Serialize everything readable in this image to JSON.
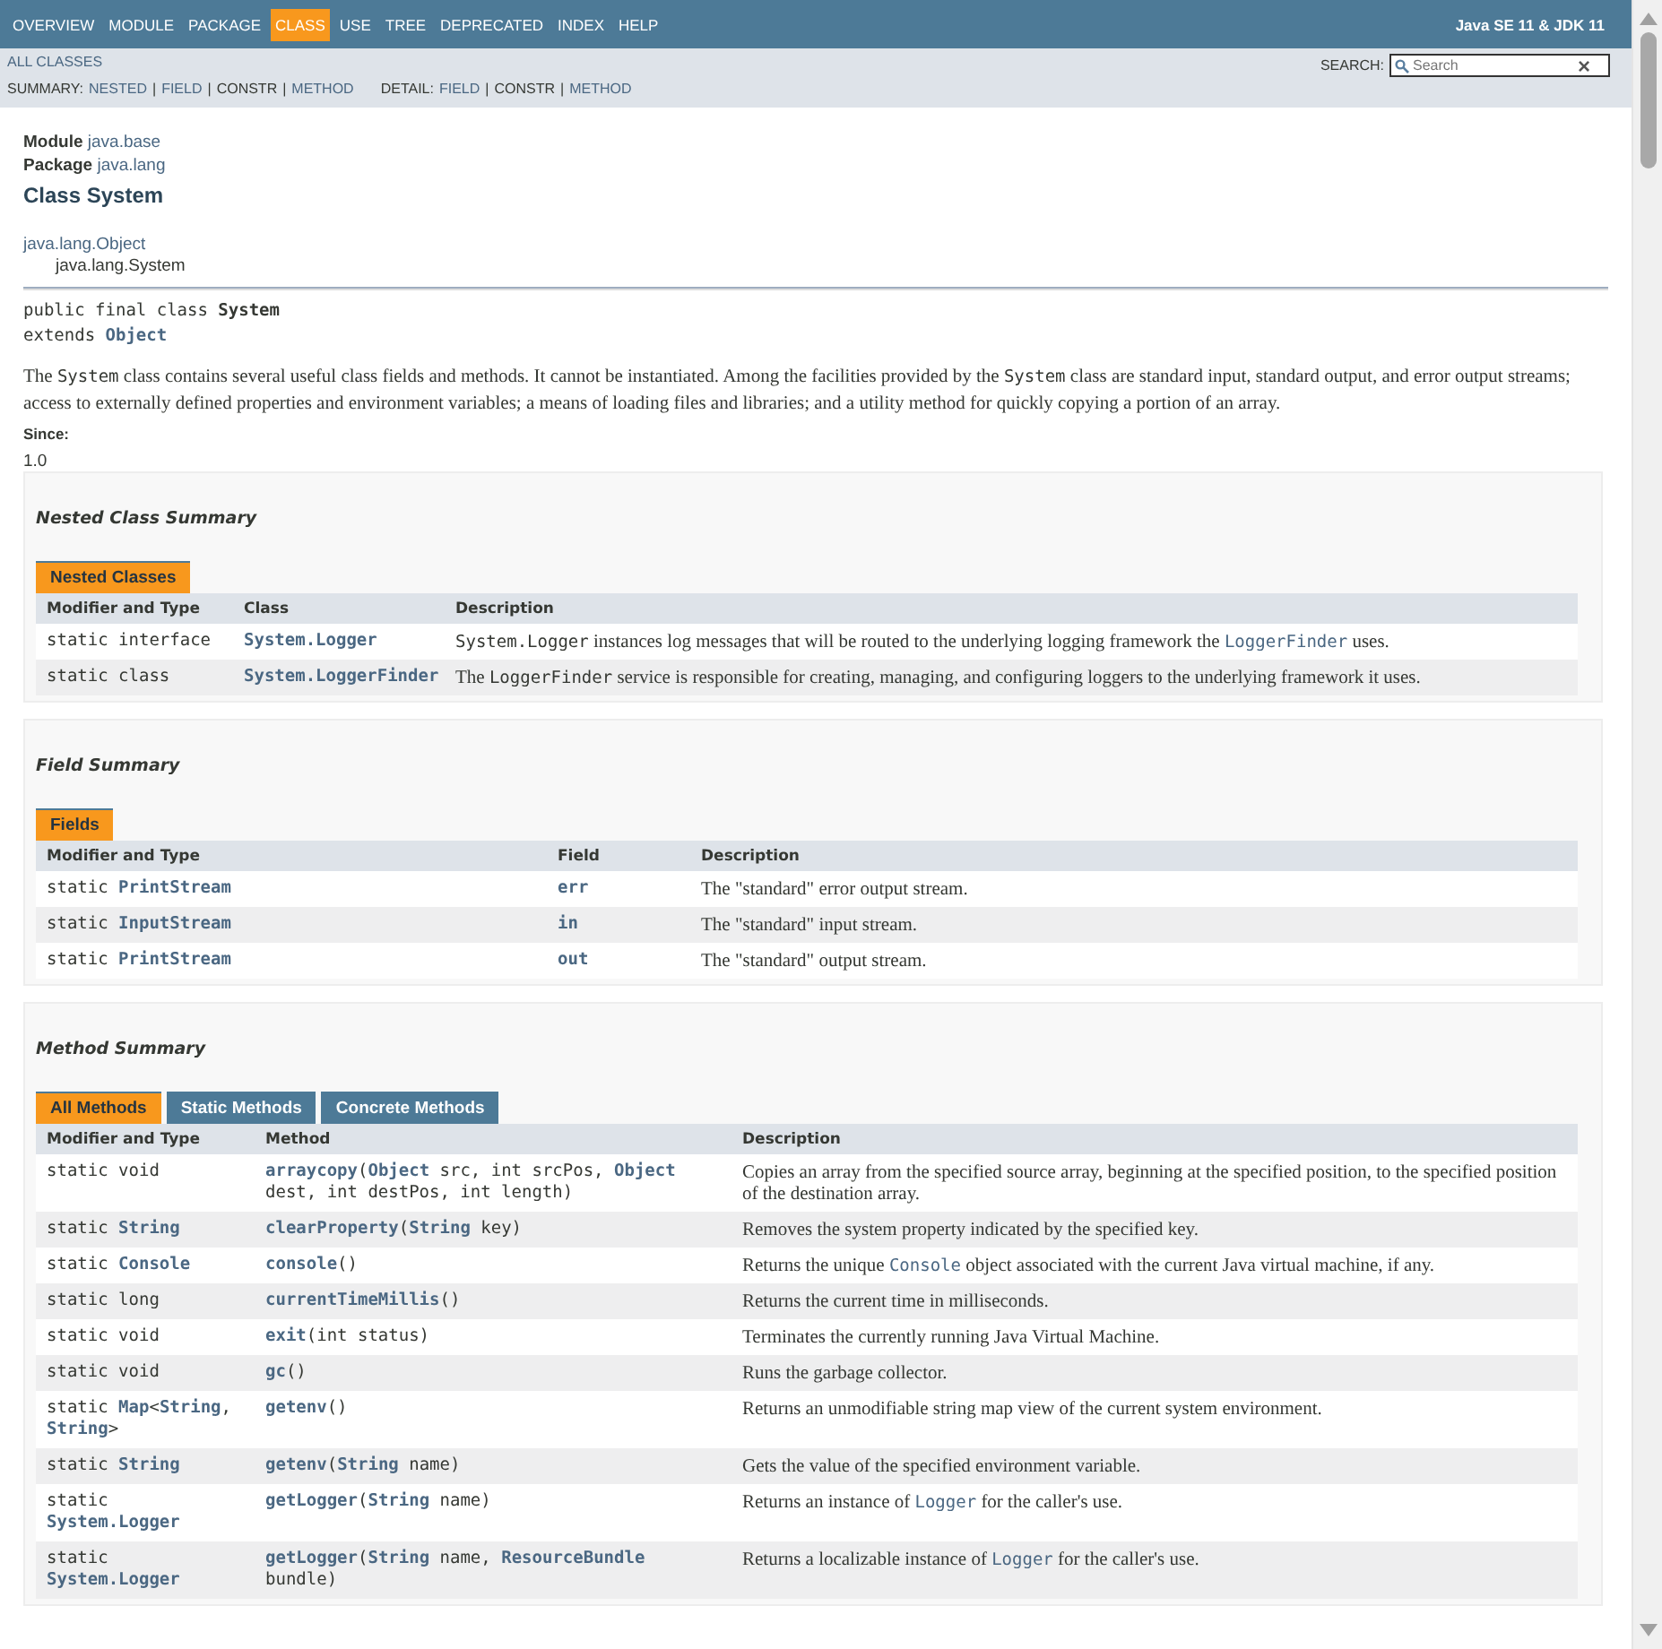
{
  "nav": {
    "items": [
      {
        "label": "OVERVIEW",
        "selected": false
      },
      {
        "label": "MODULE",
        "selected": false
      },
      {
        "label": "PACKAGE",
        "selected": false
      },
      {
        "label": "CLASS",
        "selected": true
      },
      {
        "label": "USE",
        "selected": false
      },
      {
        "label": "TREE",
        "selected": false
      },
      {
        "label": "DEPRECATED",
        "selected": false
      },
      {
        "label": "INDEX",
        "selected": false
      },
      {
        "label": "HELP",
        "selected": false
      }
    ],
    "product": "Java SE 11 & JDK 11"
  },
  "subnav": {
    "all_classes": "ALL CLASSES",
    "separator": "|",
    "summary": {
      "label": "SUMMARY:",
      "items": [
        {
          "label": "NESTED",
          "disabled": false
        },
        {
          "label": "FIELD",
          "disabled": false
        },
        {
          "label": "CONSTR",
          "disabled": true
        },
        {
          "label": "METHOD",
          "disabled": false
        }
      ]
    },
    "detail": {
      "label": "DETAIL:",
      "items": [
        {
          "label": "FIELD",
          "disabled": false
        },
        {
          "label": "CONSTR",
          "disabled": true
        },
        {
          "label": "METHOD",
          "disabled": false
        }
      ]
    },
    "search": {
      "label": "SEARCH:",
      "placeholder": "Search",
      "clear": "×"
    }
  },
  "header": {
    "module_label": "Module",
    "module": "java.base",
    "package_label": "Package",
    "package": "java.lang",
    "title": "Class System",
    "hierarchy": [
      "java.lang.Object",
      "java.lang.System"
    ],
    "declaration": [
      [
        {
          "kind": "code",
          "text": "public final class "
        },
        {
          "kind": "bold",
          "text": "System"
        }
      ],
      [
        {
          "kind": "code",
          "text": "extends "
        },
        {
          "kind": "link",
          "text": "Object"
        }
      ]
    ],
    "description": [
      {
        "kind": "text",
        "text": "The "
      },
      {
        "kind": "code",
        "text": "System"
      },
      {
        "kind": "text",
        "text": " class contains several useful class fields and methods. It cannot be instantiated. Among the facilities provided by the "
      },
      {
        "kind": "code",
        "text": "System"
      },
      {
        "kind": "text",
        "text": " class are standard input, standard output, and error output streams; access to externally defined properties and environment variables; a means of loading files and libraries; and a utility method for quickly copying a portion of an array."
      }
    ],
    "since_label": "Since:",
    "since": "1.0"
  },
  "sections": [
    {
      "kind": "nested",
      "title": "Nested Class Summary",
      "tabs": [
        {
          "label": "Nested Classes",
          "selected": true
        }
      ],
      "columns": [
        "Modifier and Type",
        "Class",
        "Description"
      ],
      "rows": [
        [
          [
            {
              "kind": "code",
              "text": "static interface"
            }
          ],
          [
            {
              "kind": "link",
              "text": "System.Logger"
            }
          ],
          [
            {
              "kind": "code",
              "text": "System.Logger"
            },
            {
              "kind": "text",
              "text": " instances log messages that will be routed to the underlying logging framework the "
            },
            {
              "kind": "ref",
              "text": "LoggerFinder"
            },
            {
              "kind": "text",
              "text": " uses."
            }
          ]
        ],
        [
          [
            {
              "kind": "code",
              "text": "static class"
            }
          ],
          [
            {
              "kind": "link",
              "text": "System.LoggerFinder"
            }
          ],
          [
            {
              "kind": "text",
              "text": "The "
            },
            {
              "kind": "code",
              "text": "LoggerFinder"
            },
            {
              "kind": "text",
              "text": " service is responsible for creating, managing, and configuring loggers to the underlying framework it uses."
            }
          ]
        ]
      ]
    },
    {
      "kind": "field",
      "title": "Field Summary",
      "tabs": [
        {
          "label": "Fields",
          "selected": true
        }
      ],
      "columns": [
        "Modifier and Type",
        "Field",
        "Description"
      ],
      "rows": [
        [
          [
            {
              "kind": "code",
              "text": "static "
            },
            {
              "kind": "link",
              "text": "PrintStream"
            }
          ],
          [
            {
              "kind": "link",
              "text": "err"
            }
          ],
          [
            {
              "kind": "text",
              "text": "The \"standard\" error output stream."
            }
          ]
        ],
        [
          [
            {
              "kind": "code",
              "text": "static "
            },
            {
              "kind": "link",
              "text": "InputStream"
            }
          ],
          [
            {
              "kind": "link",
              "text": "in"
            }
          ],
          [
            {
              "kind": "text",
              "text": "The \"standard\" input stream."
            }
          ]
        ],
        [
          [
            {
              "kind": "code",
              "text": "static "
            },
            {
              "kind": "link",
              "text": "PrintStream"
            }
          ],
          [
            {
              "kind": "link",
              "text": "out"
            }
          ],
          [
            {
              "kind": "text",
              "text": "The \"standard\" output stream."
            }
          ]
        ]
      ]
    },
    {
      "kind": "method",
      "title": "Method Summary",
      "tabs": [
        {
          "label": "All Methods",
          "selected": true
        },
        {
          "label": "Static Methods",
          "selected": false
        },
        {
          "label": "Concrete Methods",
          "selected": false
        }
      ],
      "columns": [
        "Modifier and Type",
        "Method",
        "Description"
      ],
      "rows": [
        [
          [
            {
              "kind": "code",
              "text": "static void"
            }
          ],
          [
            {
              "kind": "link",
              "text": "arraycopy"
            },
            {
              "kind": "code",
              "text": "("
            },
            {
              "kind": "link",
              "text": "Object"
            },
            {
              "kind": "code",
              "text": " src, int srcPos, "
            },
            {
              "kind": "link",
              "text": "Object"
            },
            {
              "kind": "code",
              "text": " dest, int destPos, int length)"
            }
          ],
          [
            {
              "kind": "text",
              "text": "Copies an array from the specified source array, beginning at the specified position, to the specified position of the destination array."
            }
          ]
        ],
        [
          [
            {
              "kind": "code",
              "text": "static "
            },
            {
              "kind": "link",
              "text": "String"
            }
          ],
          [
            {
              "kind": "link",
              "text": "clearProperty"
            },
            {
              "kind": "code",
              "text": "("
            },
            {
              "kind": "link",
              "text": "String"
            },
            {
              "kind": "code",
              "text": " key)"
            }
          ],
          [
            {
              "kind": "text",
              "text": "Removes the system property indicated by the specified key."
            }
          ]
        ],
        [
          [
            {
              "kind": "code",
              "text": "static "
            },
            {
              "kind": "link",
              "text": "Console"
            }
          ],
          [
            {
              "kind": "link",
              "text": "console"
            },
            {
              "kind": "code",
              "text": "()"
            }
          ],
          [
            {
              "kind": "text",
              "text": "Returns the unique "
            },
            {
              "kind": "ref",
              "text": "Console"
            },
            {
              "kind": "text",
              "text": " object associated with the current Java virtual machine, if any."
            }
          ]
        ],
        [
          [
            {
              "kind": "code",
              "text": "static long"
            }
          ],
          [
            {
              "kind": "link",
              "text": "currentTimeMillis"
            },
            {
              "kind": "code",
              "text": "()"
            }
          ],
          [
            {
              "kind": "text",
              "text": "Returns the current time in milliseconds."
            }
          ]
        ],
        [
          [
            {
              "kind": "code",
              "text": "static void"
            }
          ],
          [
            {
              "kind": "link",
              "text": "exit"
            },
            {
              "kind": "code",
              "text": "(int status)"
            }
          ],
          [
            {
              "kind": "text",
              "text": "Terminates the currently running Java Virtual Machine."
            }
          ]
        ],
        [
          [
            {
              "kind": "code",
              "text": "static void"
            }
          ],
          [
            {
              "kind": "link",
              "text": "gc"
            },
            {
              "kind": "code",
              "text": "()"
            }
          ],
          [
            {
              "kind": "text",
              "text": "Runs the garbage collector."
            }
          ]
        ],
        [
          [
            {
              "kind": "code",
              "text": "static "
            },
            {
              "kind": "link",
              "text": "Map"
            },
            {
              "kind": "code",
              "text": "<"
            },
            {
              "kind": "link",
              "text": "String"
            },
            {
              "kind": "code",
              "text": ", "
            },
            {
              "kind": "link",
              "text": "String"
            },
            {
              "kind": "code",
              "text": ">"
            }
          ],
          [
            {
              "kind": "link",
              "text": "getenv"
            },
            {
              "kind": "code",
              "text": "()"
            }
          ],
          [
            {
              "kind": "text",
              "text": "Returns an unmodifiable string map view of the current system environment."
            }
          ]
        ],
        [
          [
            {
              "kind": "code",
              "text": "static "
            },
            {
              "kind": "link",
              "text": "String"
            }
          ],
          [
            {
              "kind": "link",
              "text": "getenv"
            },
            {
              "kind": "code",
              "text": "("
            },
            {
              "kind": "link",
              "text": "String"
            },
            {
              "kind": "code",
              "text": " name)"
            }
          ],
          [
            {
              "kind": "text",
              "text": "Gets the value of the specified environment variable."
            }
          ]
        ],
        [
          [
            {
              "kind": "code",
              "text": "static "
            },
            {
              "kind": "link",
              "text": "System.Logger"
            }
          ],
          [
            {
              "kind": "link",
              "text": "getLogger"
            },
            {
              "kind": "code",
              "text": "("
            },
            {
              "kind": "link",
              "text": "String"
            },
            {
              "kind": "code",
              "text": " name)"
            }
          ],
          [
            {
              "kind": "text",
              "text": "Returns an instance of "
            },
            {
              "kind": "ref",
              "text": "Logger"
            },
            {
              "kind": "text",
              "text": " for the caller's use."
            }
          ]
        ],
        [
          [
            {
              "kind": "code",
              "text": "static "
            },
            {
              "kind": "link",
              "text": "System.Logger"
            }
          ],
          [
            {
              "kind": "link",
              "text": "getLogger"
            },
            {
              "kind": "code",
              "text": "("
            },
            {
              "kind": "link",
              "text": "String"
            },
            {
              "kind": "code",
              "text": " name, "
            },
            {
              "kind": "link",
              "text": "ResourceBundle"
            },
            {
              "kind": "code",
              "text": " bundle)"
            }
          ],
          [
            {
              "kind": "text",
              "text": "Returns a localizable instance of "
            },
            {
              "kind": "ref",
              "text": "Logger"
            },
            {
              "kind": "text",
              "text": " for the caller's use."
            }
          ]
        ]
      ]
    }
  ]
}
